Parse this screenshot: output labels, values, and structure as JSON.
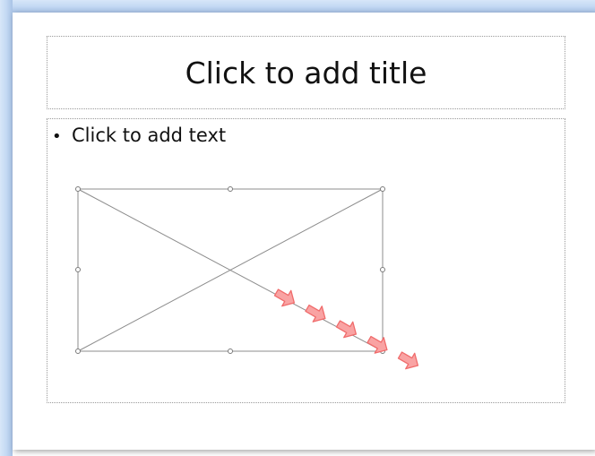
{
  "slide": {
    "title_placeholder": "Click to add title",
    "body_placeholder": "Click to add text",
    "bullet_glyph": "•"
  },
  "picture_placeholder": {
    "icon": "empty-picture-placeholder-with-diagonal-cross"
  },
  "annotation": {
    "arrow_count": 5,
    "arrow_color": "#f06b6b",
    "arrow_fill": "#f9a3a3",
    "meaning": "drag handle direction"
  },
  "colors": {
    "frame_blue": "#b9d1ef",
    "placeholder_border": "#9a9a9a",
    "text": "#111111"
  }
}
